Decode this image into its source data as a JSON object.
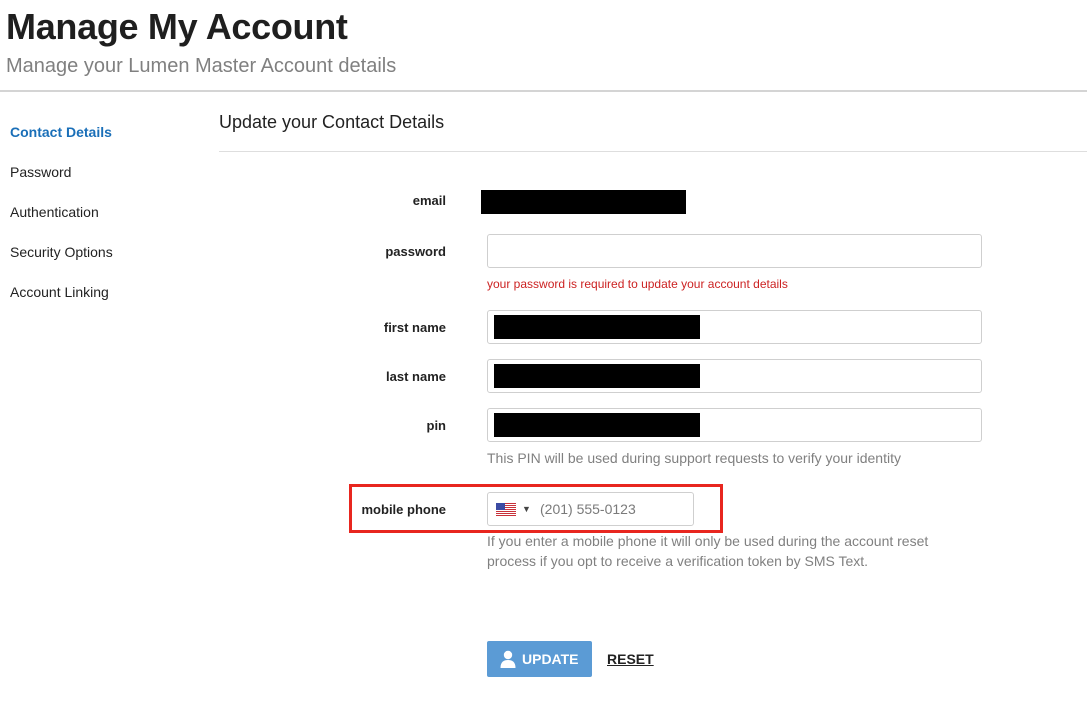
{
  "header": {
    "title": "Manage My Account",
    "subtitle": "Manage your Lumen Master Account details"
  },
  "sidebar": {
    "items": [
      {
        "label": "Contact Details",
        "active": true
      },
      {
        "label": "Password",
        "active": false
      },
      {
        "label": "Authentication",
        "active": false
      },
      {
        "label": "Security Options",
        "active": false
      },
      {
        "label": "Account Linking",
        "active": false
      }
    ]
  },
  "form": {
    "title": "Update your Contact Details",
    "email": {
      "label": "email"
    },
    "password": {
      "label": "password",
      "value": "",
      "error": "your password is required to update your account details"
    },
    "first_name": {
      "label": "first name"
    },
    "last_name": {
      "label": "last name"
    },
    "pin": {
      "label": "pin",
      "help": "This PIN will be used during support requests to verify your identity"
    },
    "mobile_phone": {
      "label": "mobile phone",
      "country_flag": "us-flag-icon",
      "placeholder": "(201) 555-0123",
      "help": "If you enter a mobile phone it will only be used during the account reset process if you opt to receive a verification token by SMS Text."
    }
  },
  "actions": {
    "update_label": "UPDATE",
    "reset_label": "RESET"
  },
  "colors": {
    "accent": "#1a6fb8",
    "button": "#5b9bd5",
    "error": "#cc2222",
    "highlight": "#e8261f"
  }
}
